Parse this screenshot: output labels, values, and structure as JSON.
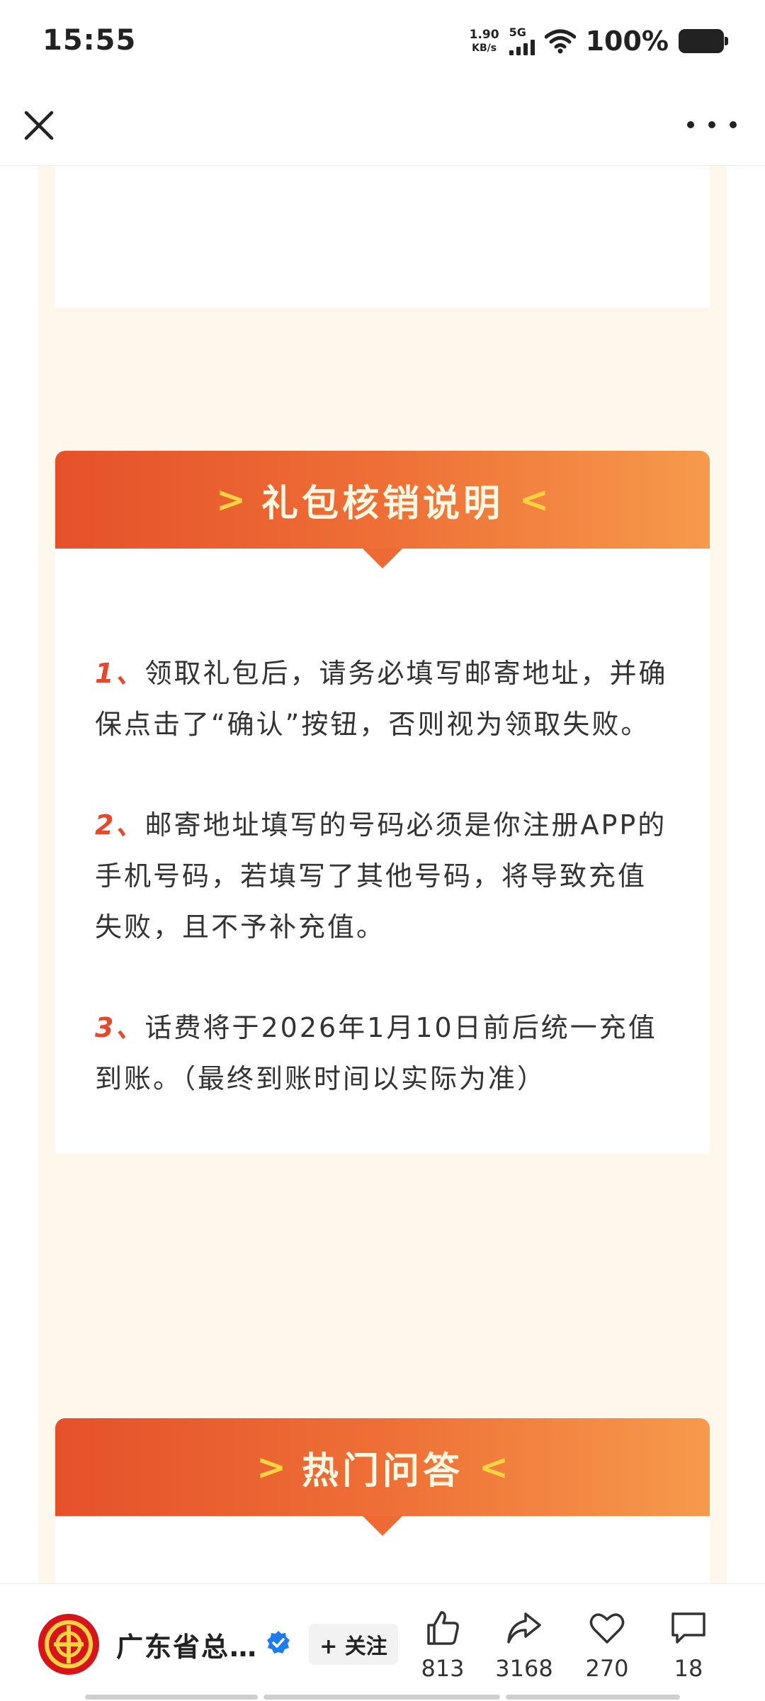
{
  "status_bar": {
    "time": "15:55",
    "net_speed_value": "1.90",
    "net_speed_unit": "KB/s",
    "signal_type": "5G",
    "battery": "100%"
  },
  "nav": {
    "close_icon": "close-icon",
    "more_icon": "more-icon"
  },
  "sections": [
    {
      "title": "礼包核销说明",
      "arrow_left": ">",
      "arrow_right": "<",
      "rules": [
        {
          "num": "1",
          "sep": "、",
          "text": "领取礼包后，请务必填写邮寄地址，并确保点击了“确认”按钮，否则视为领取失败。"
        },
        {
          "num": "2",
          "sep": "、",
          "text": "邮寄地址填写的号码必须是你注册APP的手机号码，若填写了其他号码，将导致充值失败，且不予补充值。"
        },
        {
          "num": "3",
          "sep": "、",
          "text": "话费将于2026年1月10日前后统一充值到账。（最终到账时间以实际为准）"
        }
      ]
    },
    {
      "title": "热门问答",
      "arrow_left": ">",
      "arrow_right": "<"
    }
  ],
  "bottom_bar": {
    "account_name": "广东省总…",
    "follow_label": "+ 关注",
    "likes": "813",
    "shares": "3168",
    "favorites": "270",
    "comments": "18"
  },
  "colors": {
    "accent": "#e4492b",
    "header_gradient_start": "#e5512b",
    "header_gradient_end": "#f69a4c",
    "header_arrow": "#ffd23f",
    "cream_background": "#fdf7ec",
    "verified_blue": "#1d7cf2"
  }
}
